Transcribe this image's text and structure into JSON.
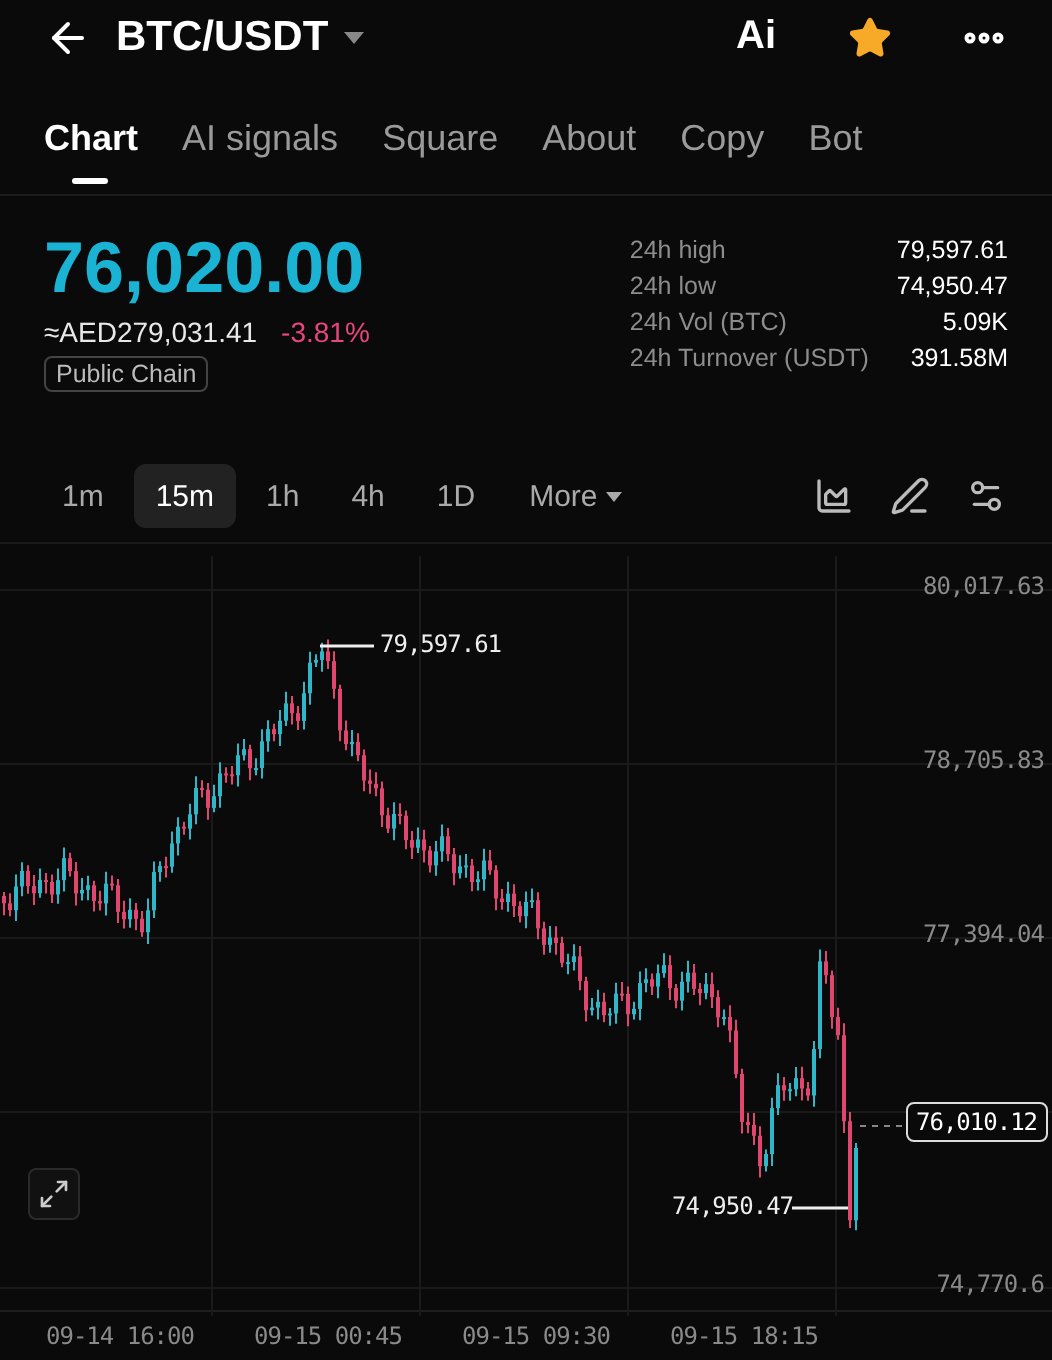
{
  "header": {
    "title": "BTC/USDT",
    "ai_label": "Ai",
    "favorited": true
  },
  "tabs": [
    {
      "label": "Chart",
      "selected": true
    },
    {
      "label": "AI signals",
      "selected": false
    },
    {
      "label": "Square",
      "selected": false
    },
    {
      "label": "About",
      "selected": false
    },
    {
      "label": "Copy",
      "selected": false
    },
    {
      "label": "Bot",
      "selected": false
    }
  ],
  "price": {
    "last": "76,020.00",
    "fiat": "≈AED279,031.41",
    "change": "-3.81%",
    "falling": true,
    "tag": "Public Chain"
  },
  "stats": [
    {
      "label": "24h high",
      "value": "79,597.61"
    },
    {
      "label": "24h low",
      "value": "74,950.47"
    },
    {
      "label": "24h Vol (BTC)",
      "value": "5.09K"
    },
    {
      "label": "24h Turnover (USDT)",
      "value": "391.58M"
    }
  ],
  "intervals": [
    {
      "label": "1m",
      "selected": false
    },
    {
      "label": "15m",
      "selected": true
    },
    {
      "label": "1h",
      "selected": false
    },
    {
      "label": "4h",
      "selected": false
    },
    {
      "label": "1D",
      "selected": false
    }
  ],
  "more": "More",
  "chart": {
    "y_axis": [
      "80,017.63",
      "78,705.83",
      "77,394.04",
      "74,770.6"
    ],
    "x_axis": [
      "09-14 16:00",
      "09-15 00:45",
      "09-15 09:30",
      "09-15 18:15"
    ],
    "high_marker": "79,597.61",
    "low_marker": "74,950.47",
    "last_price": "76,010.12"
  }
}
